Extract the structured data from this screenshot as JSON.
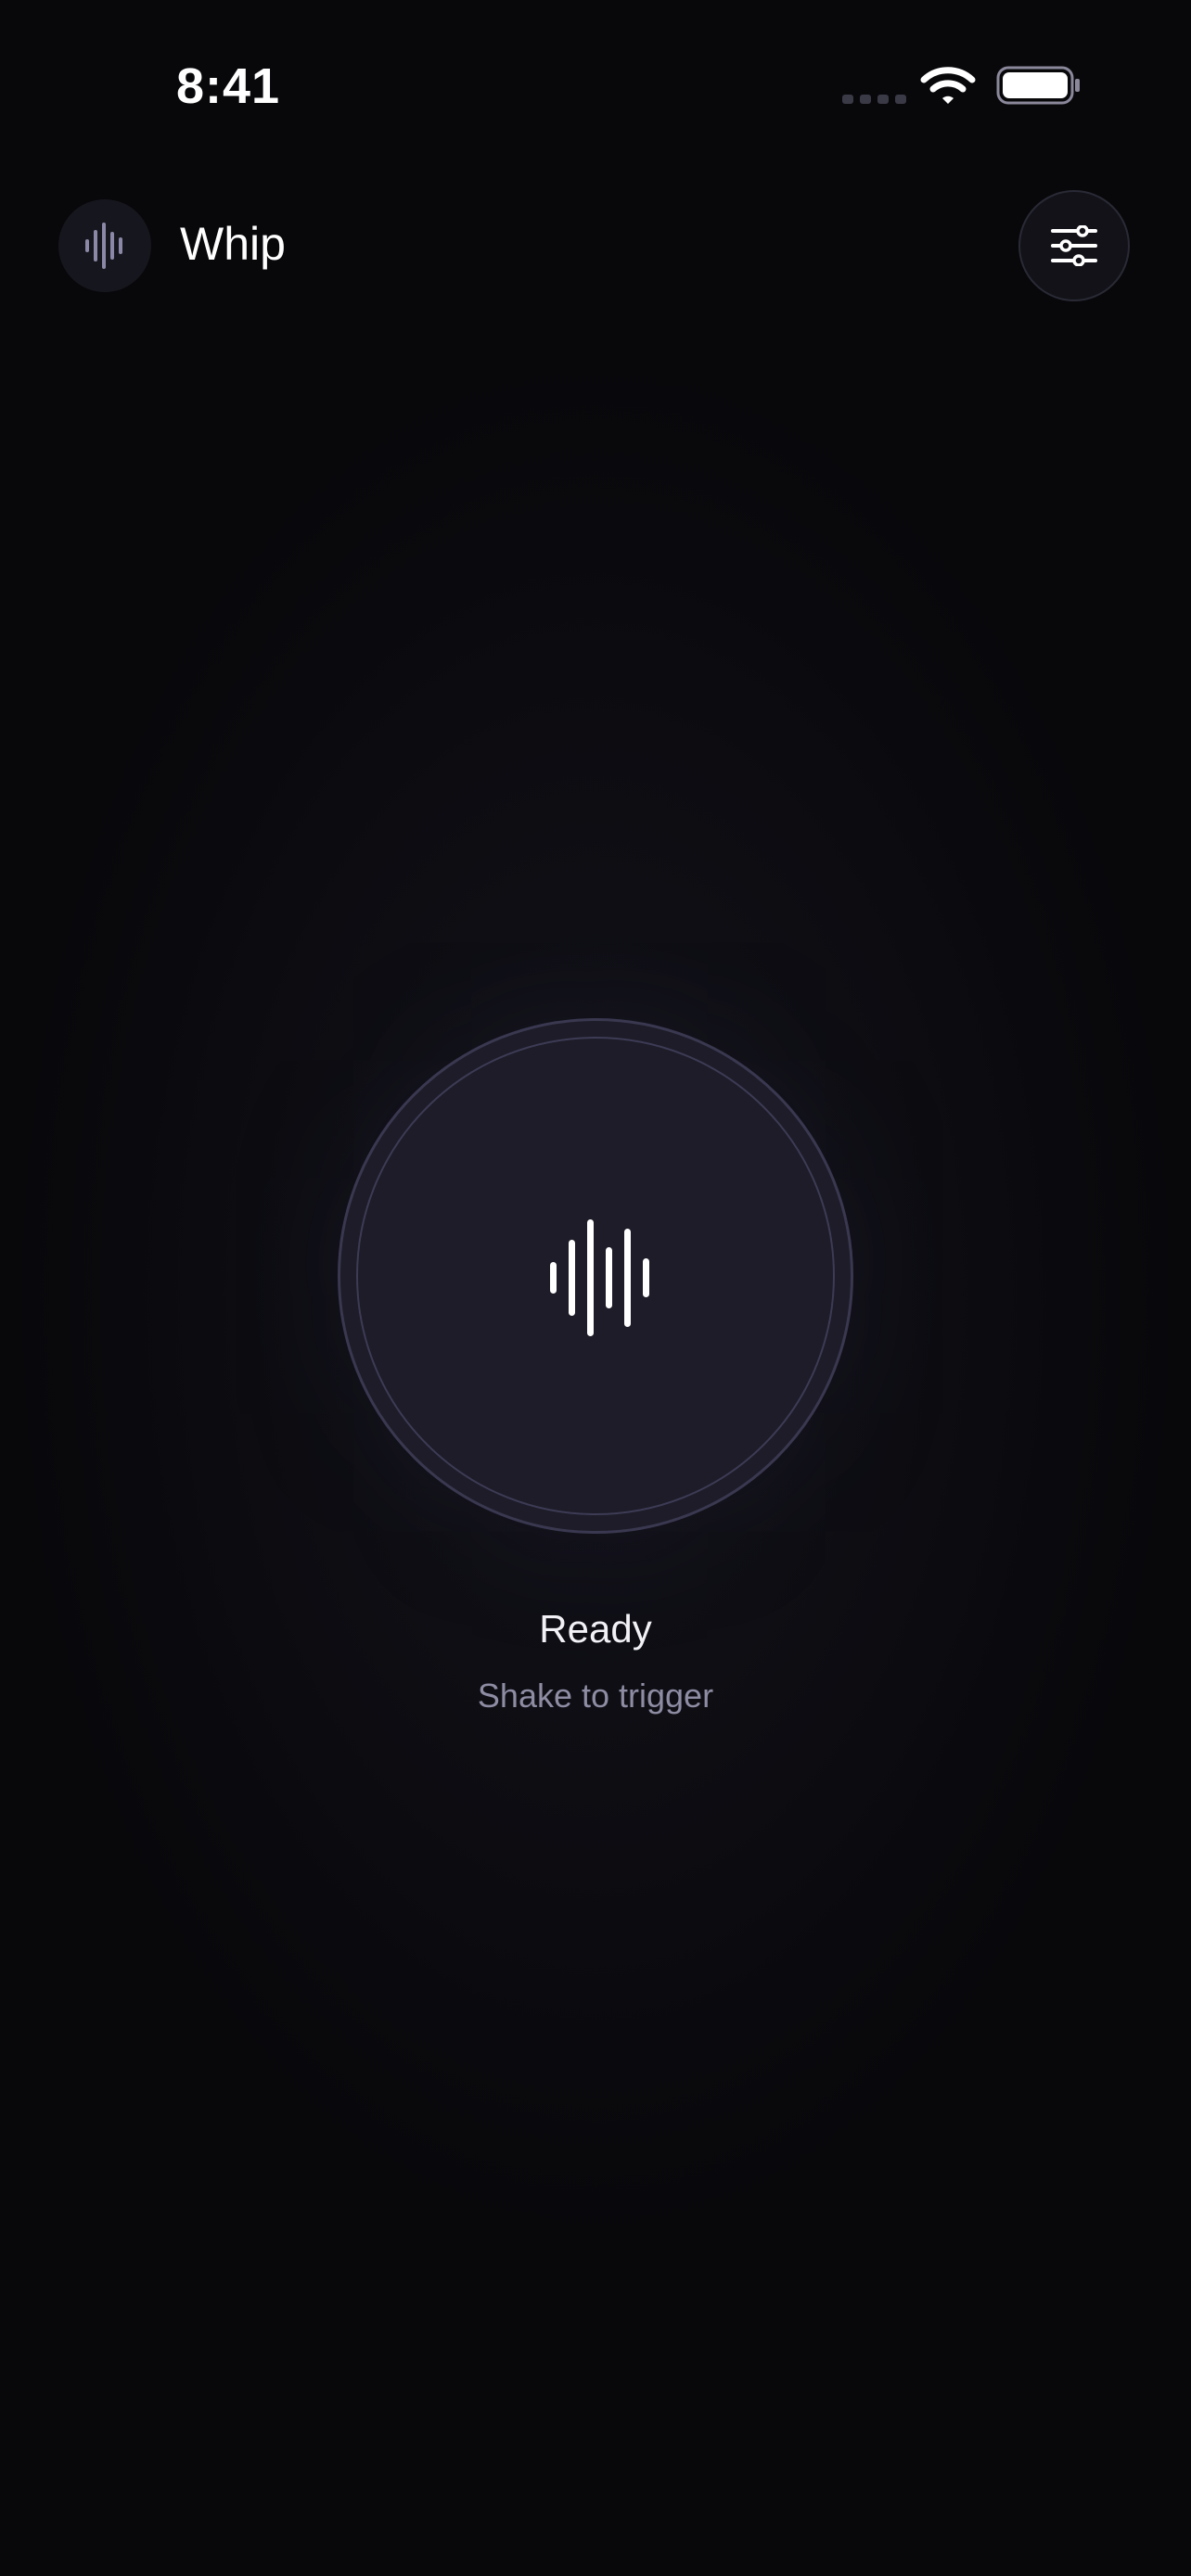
{
  "status_bar": {
    "time": "8:41"
  },
  "header": {
    "app_name": "Whip",
    "logo_icon": "waveform-icon",
    "settings_icon": "sliders-icon"
  },
  "trigger": {
    "icon": "waveform-icon",
    "status": "Ready",
    "hint": "Shake to trigger"
  },
  "colors": {
    "background": "#08080b",
    "button_fill": "#1d1c28",
    "button_ring": "#3a3850",
    "secondary_text": "#8e8ca3",
    "logo_wave": "#8a88a6"
  }
}
